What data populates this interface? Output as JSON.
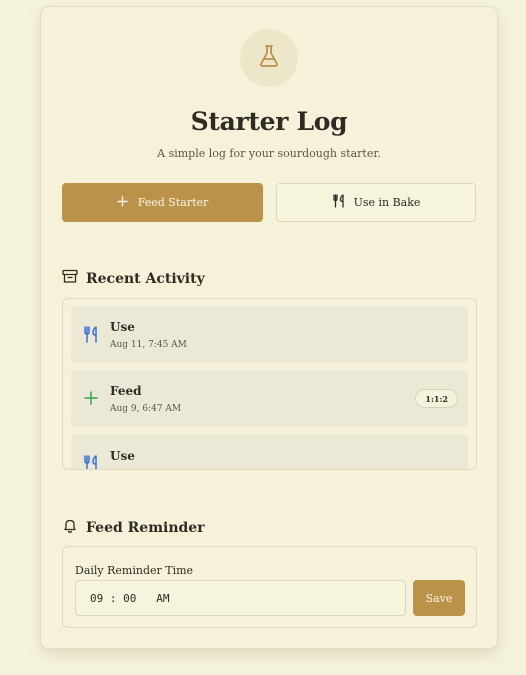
{
  "app": {
    "title": "Starter Log",
    "subtitle": "A simple log for your sourdough starter.",
    "logo_icon": "flask-icon"
  },
  "actions": {
    "feed_label": "Feed Starter",
    "feed_icon": "plus-icon",
    "use_label": "Use in Bake",
    "use_icon": "utensils-icon"
  },
  "recent_activity": {
    "heading": "Recent Activity",
    "icon": "archive-icon",
    "items": [
      {
        "type": "Use",
        "time": "Aug 11, 7:45 AM",
        "icon": "utensils-icon"
      },
      {
        "type": "Feed",
        "time": "Aug 9, 6:47 AM",
        "icon": "plus-icon",
        "ratio": "1:1:2"
      },
      {
        "type": "Use",
        "time": "",
        "icon": "utensils-icon"
      }
    ]
  },
  "reminder": {
    "heading": "Feed Reminder",
    "icon": "bell-icon",
    "label": "Daily Reminder Time",
    "time_value": "09 : 00   AM",
    "save_label": "Save"
  },
  "colors": {
    "accent": "#bb924a",
    "background": "#f6f3dc",
    "use_icon": "#3a6fd8",
    "feed_icon": "#2ea44f"
  }
}
